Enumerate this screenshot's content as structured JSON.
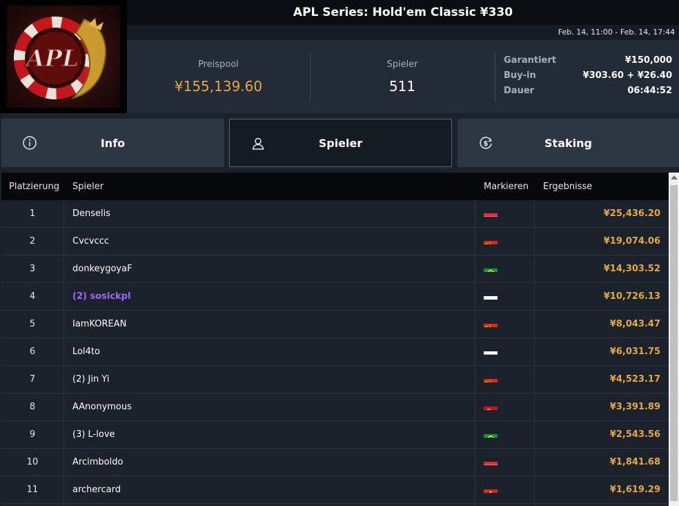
{
  "header": {
    "title": "APL Series: Hold'em Classic ¥330",
    "date_range": "Feb. 14, 11:00 - Feb. 14, 17:44",
    "logo_text": "APL"
  },
  "stats": {
    "prize_pool_label": "Preispool",
    "prize_pool_value": "¥155,139.60",
    "players_label": "Spieler",
    "players_value": "511",
    "details": [
      {
        "key": "Garantiert",
        "value": "¥150,000"
      },
      {
        "key": "Buy-in",
        "value": "¥303.60 + ¥26.40"
      },
      {
        "key": "Dauer",
        "value": "06:44:52"
      }
    ]
  },
  "tabs": [
    {
      "label": "Info",
      "icon": "info-icon"
    },
    {
      "label": "Spieler",
      "icon": "user-icon",
      "active": true
    },
    {
      "label": "Staking",
      "icon": "dollar-coin-icon"
    }
  ],
  "table": {
    "columns": [
      "Platzierung",
      "Spieler",
      "Markieren",
      "Ergebnisse"
    ],
    "rows": [
      {
        "rank": "1",
        "name": "Denselis",
        "flag": "austria",
        "winnings": "¥25,436.20"
      },
      {
        "rank": "2",
        "name": "Cvcvccc",
        "flag": "china",
        "winnings": "¥19,074.06"
      },
      {
        "rank": "3",
        "name": "donkeygoyaF",
        "flag": "brazil",
        "winnings": "¥14,303.52"
      },
      {
        "rank": "4",
        "name": "(2) sosickpl",
        "flag": "poland",
        "winnings": "¥10,726.13",
        "highlight": true
      },
      {
        "rank": "5",
        "name": "IamKOREAN",
        "flag": "china",
        "winnings": "¥8,043.47"
      },
      {
        "rank": "6",
        "name": "Lol4to",
        "flag": "russia",
        "winnings": "¥6,031.75"
      },
      {
        "rank": "7",
        "name": "(2) Jin Yi",
        "flag": "china",
        "winnings": "¥4,523.17"
      },
      {
        "rank": "8",
        "name": "AAnonymous",
        "flag": "turkey",
        "winnings": "¥3,391.89"
      },
      {
        "rank": "9",
        "name": "(3) L-love",
        "flag": "brazil",
        "winnings": "¥2,543.56"
      },
      {
        "rank": "10",
        "name": "Arcimboldo",
        "flag": "austria",
        "winnings": "¥1,841.68"
      },
      {
        "rank": "11",
        "name": "archercard",
        "flag": "hongkong",
        "winnings": "¥1,619.29"
      }
    ]
  },
  "colors": {
    "accent_gold": "#e6a942",
    "highlight_purple": "#9b6bff",
    "background": "#1b222b"
  }
}
